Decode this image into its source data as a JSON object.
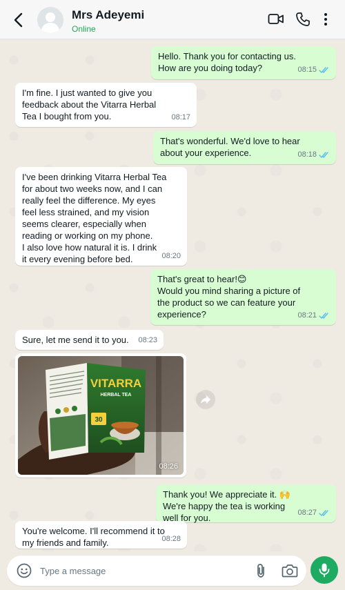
{
  "header": {
    "name": "Mrs Adeyemi",
    "status": "Online"
  },
  "messages": [
    {
      "dir": "out",
      "text": "Hello. Thank you for contacting us.\nHow are you doing today?",
      "time": "08:15",
      "read": true
    },
    {
      "dir": "in",
      "text": "I'm fine. I just wanted to give you\nfeedback about the Vitarra Herbal\nTea I bought from you.",
      "time": "08:17"
    },
    {
      "dir": "out",
      "text": "That's wonderful. We'd love to hear\nabout your experience.",
      "time": "08:18",
      "read": true
    },
    {
      "dir": "in",
      "text": "I've been drinking Vitarra Herbal Tea\nfor about two weeks now, and I can\nreally feel the difference. My eyes\nfeel less strained, and my vision\nseems clearer, especially when\nreading or working on my phone.\nI also love how natural it is. I drink\nit every evening before bed.",
      "time": "08:20"
    },
    {
      "dir": "out",
      "text": "That's great to hear!😊\nWould you mind sharing a picture of\nthe product so we can feature your\nexperience?",
      "time": "08:21",
      "read": true
    },
    {
      "dir": "in",
      "text": "Sure, let me send it to you.",
      "time": "08:23"
    },
    {
      "dir": "out",
      "text": "Thank you! We appreciate it. 🙌\nWe're happy the tea is working\nwell for you.",
      "time": "08:27",
      "read": true
    },
    {
      "dir": "in",
      "text": "You're welcome. I'll recommend it to\nmy friends and family.",
      "time": "08:28"
    }
  ],
  "photo_message": {
    "time": "08:26",
    "product_brand": "VITARRA",
    "product_subtitle": "HERBAL TEA",
    "product_count": "30"
  },
  "composer": {
    "placeholder": "Type a message"
  },
  "colors": {
    "outgoing_bubble": "#d9fdd3",
    "incoming_bubble": "#ffffff",
    "read_ticks": "#53bdeb",
    "mic_button": "#1daa61",
    "online_status": "#25a35a"
  },
  "icons": {
    "back": "arrow-left-icon",
    "video": "video-call-icon",
    "phone": "phone-icon",
    "menu": "more-vertical-icon",
    "forward": "forward-icon",
    "emoji": "emoji-icon",
    "attach": "paperclip-icon",
    "camera": "camera-icon",
    "mic": "microphone-icon"
  }
}
